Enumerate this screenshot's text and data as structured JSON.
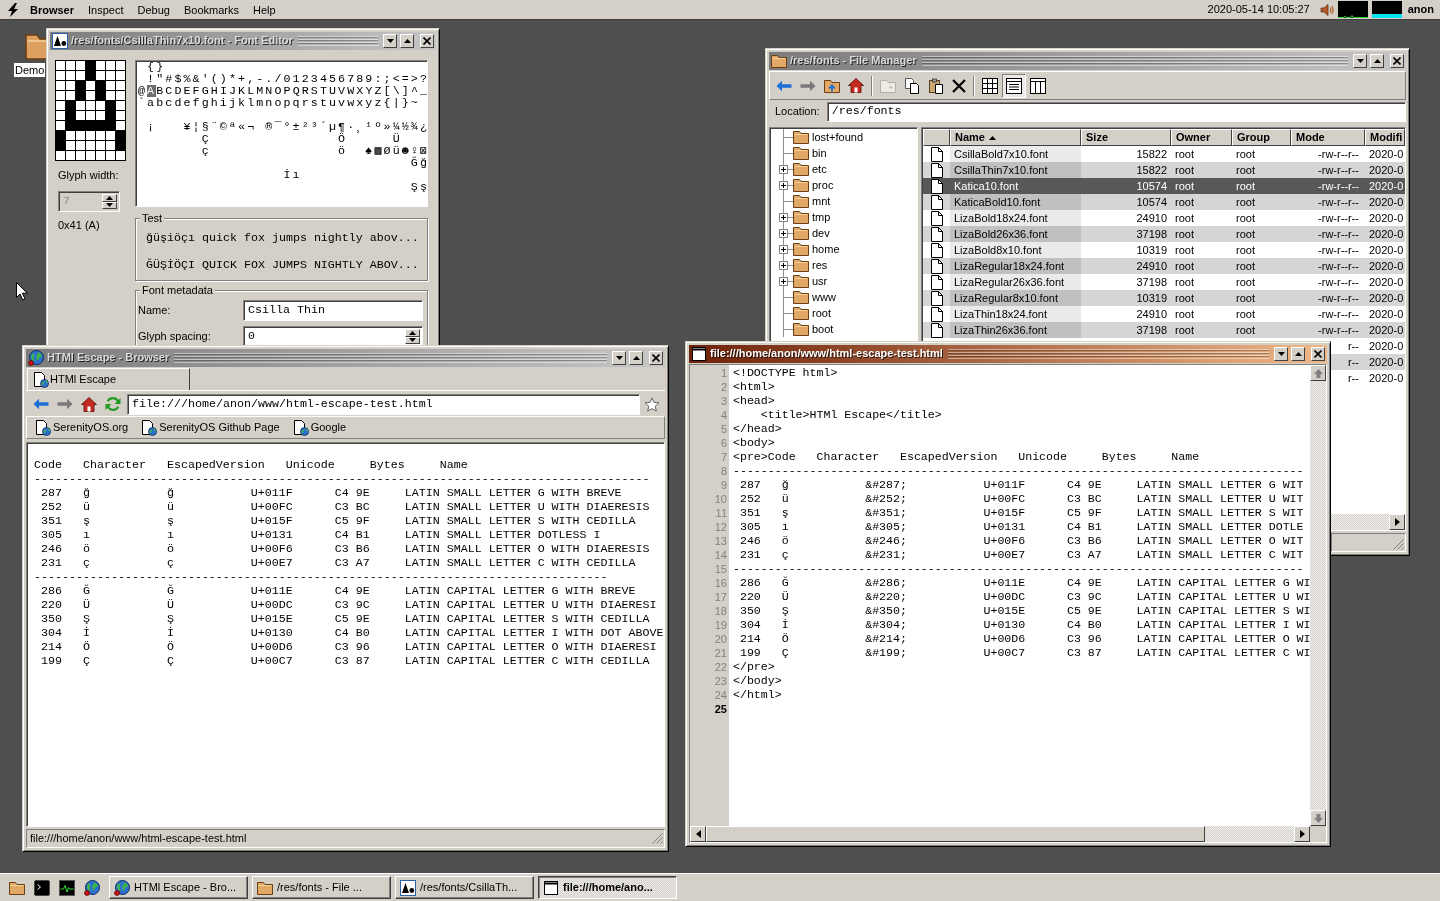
{
  "menu_bar": {
    "app_name": "Browser",
    "menus": [
      "Inspect",
      "Debug",
      "Bookmarks",
      "Help"
    ],
    "clock": "2020-05-14 10:05:27",
    "user": "anon"
  },
  "desktop_icons": [
    {
      "label": "Demo"
    }
  ],
  "windows": [
    {
      "kind": "font_editor",
      "title": "/res/fonts/CsillaThin7x10.font - Font Editor",
      "active": false,
      "glyph_bitmap": [
        [
          false,
          false,
          false,
          true,
          false,
          false,
          false
        ],
        [
          false,
          false,
          false,
          true,
          false,
          false,
          false
        ],
        [
          false,
          false,
          true,
          false,
          true,
          false,
          false
        ],
        [
          false,
          false,
          true,
          false,
          true,
          false,
          false
        ],
        [
          false,
          true,
          false,
          false,
          false,
          true,
          false
        ],
        [
          false,
          true,
          false,
          false,
          false,
          true,
          false
        ],
        [
          false,
          true,
          true,
          true,
          true,
          true,
          false
        ],
        [
          true,
          false,
          false,
          false,
          false,
          false,
          true
        ],
        [
          true,
          false,
          false,
          false,
          false,
          false,
          true
        ],
        [
          false,
          false,
          false,
          false,
          false,
          false,
          false
        ]
      ],
      "glyph_width_label": "Glyph width:",
      "glyph_width": {
        "value": "7",
        "disabled": true
      },
      "glyph_code": "0x41 (A)",
      "glyph_map": [
        [
          {
            "text": " {}",
            "selected": false
          }
        ],
        [
          {
            "text": " !\"#$%&'()*+,-./0123456789:;<=>?",
            "selected": false
          }
        ],
        [
          {
            "text": "@",
            "selected": false
          },
          {
            "text": "A",
            "selected": true
          },
          {
            "text": "BCDEFGHIJKLMNOPQRSTUVWXYZ[\\]^_",
            "selected": false
          }
        ],
        [
          {
            "text": "`abcdefghijklmnopqrstuvwxyz{|}~",
            "selected": false
          }
        ],
        [
          {
            "text": " ¡   ¥¦§¨©ª«¬ ®¯°±²³´µ¶·¸¹º»¼½¾¿",
            "selected": false
          }
        ],
        [
          {
            "text": "       Ç              Ö     Ü",
            "selected": false
          }
        ],
        [
          {
            "text": "       ç              ö  ♠▩Øü☻♀⊠",
            "selected": false
          }
        ],
        [
          {
            "text": "                              Ğğ",
            "selected": false
          }
        ],
        [
          {
            "text": "                İı",
            "selected": false
          }
        ],
        [
          {
            "text": "                              Şş",
            "selected": false
          }
        ]
      ],
      "test": {
        "title": "Test",
        "lines": [
          "ğüşiöçı quick fox jumps nightly abov...",
          "ĞÜŞİÖÇI QUICK FOX JUMPS NIGHTLY ABOV..."
        ]
      },
      "metadata": {
        "title": "Font metadata",
        "fields": [
          {
            "label": "Name:",
            "value": "Csilla Thin",
            "kind": "text"
          },
          {
            "label": "Glyph spacing:",
            "value": "0",
            "kind": "spin"
          }
        ]
      }
    },
    {
      "kind": "file_manager",
      "title": "/res/fonts - File Manager",
      "active": false,
      "views": [
        {
          "selected": false
        },
        {
          "selected": true
        },
        {
          "selected": false
        }
      ],
      "location_label": "Location:",
      "location": "/res/fonts",
      "tree": [
        {
          "label": "lost+found",
          "expandable": false
        },
        {
          "label": "bin",
          "expandable": false
        },
        {
          "label": "etc",
          "expandable": true
        },
        {
          "label": "proc",
          "expandable": true
        },
        {
          "label": "mnt",
          "expandable": false
        },
        {
          "label": "tmp",
          "expandable": true
        },
        {
          "label": "dev",
          "expandable": true
        },
        {
          "label": "home",
          "expandable": true
        },
        {
          "label": "res",
          "expandable": true
        },
        {
          "label": "usr",
          "expandable": true
        },
        {
          "label": "www",
          "expandable": false
        },
        {
          "label": "root",
          "expandable": false
        },
        {
          "label": "boot",
          "expandable": false
        }
      ],
      "columns": [
        {
          "label": "Name",
          "sorted": true
        },
        {
          "label": "Size",
          "sorted": false
        },
        {
          "label": "Owner",
          "sorted": false
        },
        {
          "label": "Group",
          "sorted": false
        },
        {
          "label": "Mode",
          "sorted": false
        },
        {
          "label": "Modifi",
          "sorted": false
        }
      ],
      "rows": [
        {
          "name": "CsillaBold7x10.font",
          "size": "15822",
          "owner": "root",
          "group": "root",
          "mode": "-rw-r--r--",
          "modified": "2020-0",
          "selected": false
        },
        {
          "name": "CsillaThin7x10.font",
          "size": "15822",
          "owner": "root",
          "group": "root",
          "mode": "-rw-r--r--",
          "modified": "2020-0",
          "selected": false
        },
        {
          "name": "Katica10.font",
          "size": "10574",
          "owner": "root",
          "group": "root",
          "mode": "-rw-r--r--",
          "modified": "2020-0",
          "selected": true
        },
        {
          "name": "KaticaBold10.font",
          "size": "10574",
          "owner": "root",
          "group": "root",
          "mode": "-rw-r--r--",
          "modified": "2020-0",
          "selected": false
        },
        {
          "name": "LizaBold18x24.font",
          "size": "24910",
          "owner": "root",
          "group": "root",
          "mode": "-rw-r--r--",
          "modified": "2020-0",
          "selected": false
        },
        {
          "name": "LizaBold26x36.font",
          "size": "37198",
          "owner": "root",
          "group": "root",
          "mode": "-rw-r--r--",
          "modified": "2020-0",
          "selected": false
        },
        {
          "name": "LizaBold8x10.font",
          "size": "10319",
          "owner": "root",
          "group": "root",
          "mode": "-rw-r--r--",
          "modified": "2020-0",
          "selected": false
        },
        {
          "name": "LizaRegular18x24.font",
          "size": "24910",
          "owner": "root",
          "group": "root",
          "mode": "-rw-r--r--",
          "modified": "2020-0",
          "selected": false
        },
        {
          "name": "LizaRegular26x36.font",
          "size": "37198",
          "owner": "root",
          "group": "root",
          "mode": "-rw-r--r--",
          "modified": "2020-0",
          "selected": false
        },
        {
          "name": "LizaRegular8x10.font",
          "size": "10319",
          "owner": "root",
          "group": "root",
          "mode": "-rw-r--r--",
          "modified": "2020-0",
          "selected": false
        },
        {
          "name": "LizaThin18x24.font",
          "size": "24910",
          "owner": "root",
          "group": "root",
          "mode": "-rw-r--r--",
          "modified": "2020-0",
          "selected": false
        },
        {
          "name": "LizaThin26x36.font",
          "size": "37198",
          "owner": "root",
          "group": "root",
          "mode": "-rw-r--r--",
          "modified": "2020-0",
          "selected": false
        },
        {
          "mode": "r--",
          "modified": "2020-0",
          "selected": false
        },
        {
          "mode": "r--",
          "modified": "2020-0",
          "selected": false
        },
        {
          "mode": "r--",
          "modified": "2020-0",
          "selected": false
        }
      ]
    },
    {
      "kind": "browser",
      "title": "HTMl Escape - Browser",
      "active": false,
      "tabs": [
        {
          "label": "HTMl Escape",
          "selected": true
        }
      ],
      "url": "file:///home/anon/www/html-escape-test.html",
      "bookmarks": [
        {
          "label": "SerenityOS.org"
        },
        {
          "label": "SerenityOS Github Page"
        },
        {
          "label": "Google"
        }
      ],
      "content_lines": [
        "Code   Character   EscapedVersion   Unicode     Bytes     Name",
        "----------------------------------------------------------------------------------------",
        " 287   ğ           ğ           U+011F      C4 9E     LATIN SMALL LETTER G WITH BREVE",
        " 252   ü           ü           U+00FC      C3 BC     LATIN SMALL LETTER U WITH DIAERESIS",
        " 351   ş           ş           U+015F      C5 9F     LATIN SMALL LETTER S WITH CEDILLA",
        " 305   ı           ı           U+0131      C4 B1     LATIN SMALL LETTER DOTLESS I",
        " 246   ö           ö           U+00F6      C3 B6     LATIN SMALL LETTER O WITH DIAERESIS",
        " 231   ç           ç           U+00E7      C3 A7     LATIN SMALL LETTER C WITH CEDILLA",
        "----------------------------------------------------------------------------------",
        " 286   Ğ           Ğ           U+011E      C4 9E     LATIN CAPITAL LETTER G WITH BREVE",
        " 220   Ü           Ü           U+00DC      C3 9C     LATIN CAPITAL LETTER U WITH DIAERESI",
        " 350   Ş           Ş           U+015E      C5 9E     LATIN CAPITAL LETTER S WITH CEDILLA",
        " 304   İ           İ           U+0130      C4 B0     LATIN CAPITAL LETTER I WITH DOT ABOVE",
        " 214   Ö           Ö           U+00D6      C3 96     LATIN CAPITAL LETTER O WITH DIAERESI",
        " 199   Ç           Ç           U+00C7      C3 87     LATIN CAPITAL LETTER C WITH CEDILLA"
      ],
      "status": "file:///home/anon/www/html-escape-test.html"
    },
    {
      "kind": "text_editor",
      "title": "file:///home/anon/www/html-escape-test.html",
      "active": true,
      "lines": [
        {
          "number": "1",
          "text": "<!DOCTYPE html>",
          "current": false
        },
        {
          "number": "2",
          "text": "<html>",
          "current": false
        },
        {
          "number": "3",
          "text": "<head>",
          "current": false
        },
        {
          "number": "4",
          "text": "    <title>HTMl Escape</title>",
          "current": false
        },
        {
          "number": "5",
          "text": "</head>",
          "current": false
        },
        {
          "number": "6",
          "text": "<body>",
          "current": false
        },
        {
          "number": "7",
          "text": "<pre>Code   Character   EscapedVersion   Unicode     Bytes     Name",
          "current": false
        },
        {
          "number": "8",
          "text": "----------------------------------------------------------------------------------",
          "current": false
        },
        {
          "number": "9",
          "text": " 287   ğ           &#287;           U+011F      C4 9E     LATIN SMALL LETTER G WIT",
          "current": false
        },
        {
          "number": "10",
          "text": " 252   ü           &#252;           U+00FC      C3 BC     LATIN SMALL LETTER U WIT",
          "current": false
        },
        {
          "number": "11",
          "text": " 351   ş           &#351;           U+015F      C5 9F     LATIN SMALL LETTER S WIT",
          "current": false
        },
        {
          "number": "12",
          "text": " 305   ı           &#305;           U+0131      C4 B1     LATIN SMALL LETTER DOTLE",
          "current": false
        },
        {
          "number": "13",
          "text": " 246   ö           &#246;           U+00F6      C3 B6     LATIN SMALL LETTER O WIT",
          "current": false
        },
        {
          "number": "14",
          "text": " 231   ç           &#231;           U+00E7      C3 A7     LATIN SMALL LETTER C WIT",
          "current": false
        },
        {
          "number": "15",
          "text": "----------------------------------------------------------------------------------",
          "current": false
        },
        {
          "number": "16",
          "text": " 286   Ğ           &#286;           U+011E      C4 9E     LATIN CAPITAL LETTER G WI",
          "current": false
        },
        {
          "number": "17",
          "text": " 220   Ü           &#220;           U+00DC      C3 9C     LATIN CAPITAL LETTER U WI",
          "current": false
        },
        {
          "number": "18",
          "text": " 350   Ş           &#350;           U+015E      C5 9E     LATIN CAPITAL LETTER S WI",
          "current": false
        },
        {
          "number": "19",
          "text": " 304   İ           &#304;           U+0130      C4 B0     LATIN CAPITAL LETTER I WI",
          "current": false
        },
        {
          "number": "20",
          "text": " 214   Ö           &#214;           U+00D6      C3 96     LATIN CAPITAL LETTER O WI",
          "current": false
        },
        {
          "number": "21",
          "text": " 199   Ç           &#199;           U+00C7      C3 87     LATIN CAPITAL LETTER C WI",
          "current": false
        },
        {
          "number": "22",
          "text": "</pre>",
          "current": false
        },
        {
          "number": "23",
          "text": "</body>",
          "current": false
        },
        {
          "number": "24",
          "text": "</html>",
          "current": false
        },
        {
          "number": "25",
          "current": true
        }
      ]
    }
  ],
  "taskbar": {
    "buttons": [
      {
        "kind": "browser",
        "label": "HTMl Escape - Bro...",
        "selected": false
      },
      {
        "kind": "file_manager",
        "label": "/res/fonts - File ...",
        "selected": false
      },
      {
        "kind": "font_editor",
        "label": "/res/fonts/CsillaTh...",
        "selected": false
      },
      {
        "kind": "text_editor",
        "label": "file:///home/ano...",
        "selected": true
      }
    ]
  }
}
